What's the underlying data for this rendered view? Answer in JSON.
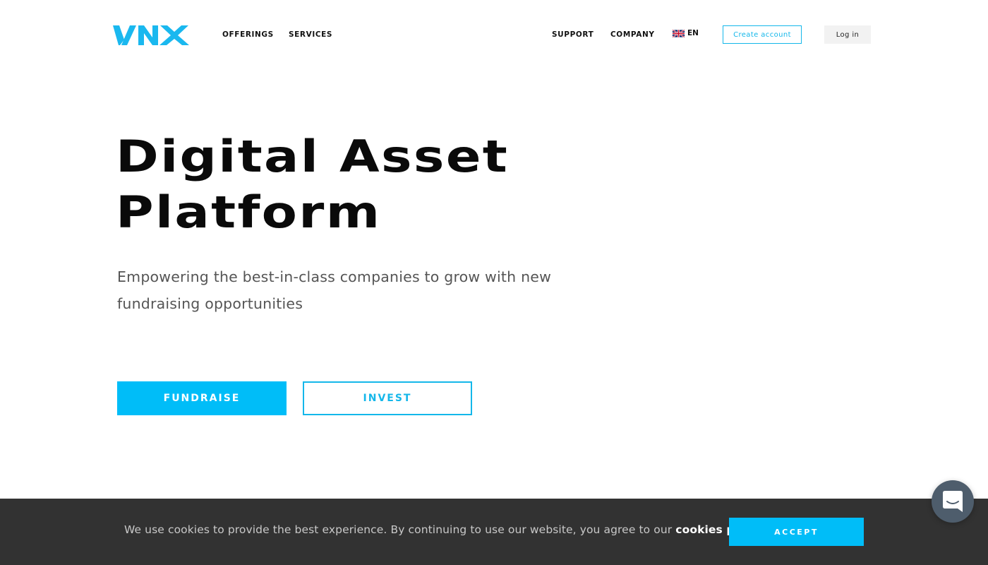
{
  "header": {
    "logo_text": "VNX",
    "nav_left": [
      {
        "label": "OFFERINGS"
      },
      {
        "label": "SERVICES"
      }
    ],
    "nav_right": [
      {
        "label": "SUPPORT"
      },
      {
        "label": "COMPANY"
      }
    ],
    "language": {
      "code": "EN",
      "flag_icon": "uk-flag-icon"
    },
    "create_account_label": "Create account",
    "login_label": "Log in"
  },
  "hero": {
    "title_line1": "Digital Asset",
    "title_line2": "Platform",
    "subtitle": "Empowering the best-in-class companies to grow with new fundraising opportunities",
    "fundraise_label": "FUNDRAISE",
    "invest_label": "INVEST"
  },
  "cookie_banner": {
    "text": "We use cookies to provide the best experience. By continuing to use our website, you agree to our ",
    "link_label": "cookies policy",
    "suffix": ".",
    "accept_label": "ACCEPT"
  },
  "chat": {
    "icon": "chat-bubble-icon"
  },
  "colors": {
    "accent": "#00bdf8",
    "accent_border": "#14b7ea",
    "cookie_bg": "#323232",
    "chat_bg": "#4e5d6c"
  }
}
